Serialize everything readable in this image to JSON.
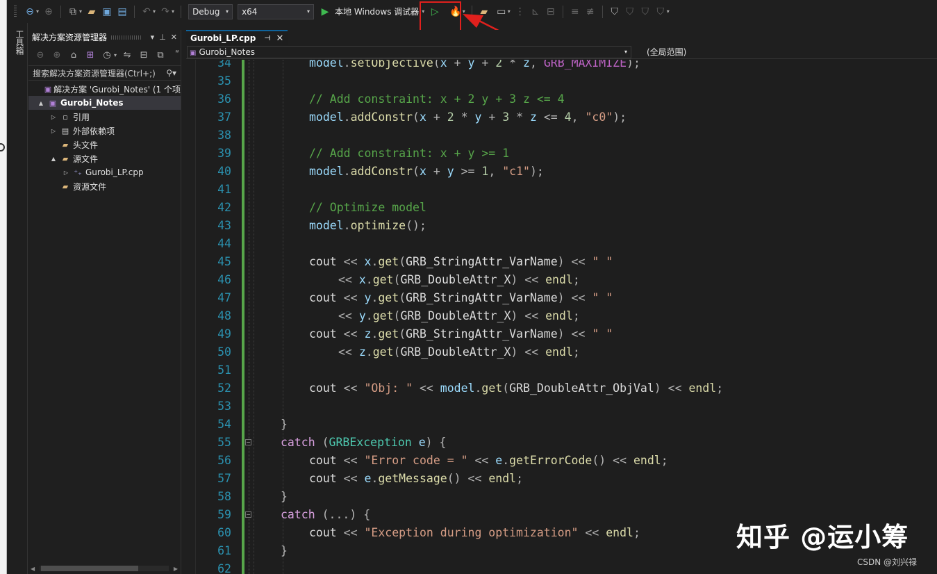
{
  "toolbar": {
    "configuration": "Debug",
    "platform": "x64",
    "run_label": "本地 Windows 调试器"
  },
  "tool_strip": {
    "label": "工具箱"
  },
  "solution_explorer": {
    "title": "解决方案资源管理器",
    "search_placeholder": "搜索解决方案资源管理器(Ctrl+;)",
    "tree": [
      {
        "label": "解决方案 'Gurobi_Notes' (1 个项",
        "icon": "solution-icon",
        "level": 0,
        "expander": ""
      },
      {
        "label": "Gurobi_Notes",
        "icon": "project-icon",
        "level": 0,
        "expander": "▲",
        "selected": true
      },
      {
        "label": "引用",
        "icon": "references-icon",
        "level": 1,
        "expander": "▷"
      },
      {
        "label": "外部依赖项",
        "icon": "external-deps-icon",
        "level": 1,
        "expander": "▷"
      },
      {
        "label": "头文件",
        "icon": "filter-folder-icon",
        "level": 1,
        "expander": ""
      },
      {
        "label": "源文件",
        "icon": "filter-folder-icon",
        "level": 1,
        "expander": "▲"
      },
      {
        "label": "Gurobi_LP.cpp",
        "icon": "cpp-file-icon",
        "level": 2,
        "expander": "▷"
      },
      {
        "label": "资源文件",
        "icon": "filter-folder-icon",
        "level": 1,
        "expander": ""
      }
    ]
  },
  "editor": {
    "tab_title": "Gurobi_LP.cpp",
    "nav_project": "Gurobi_Notes",
    "nav_scope": "(全局范围)",
    "lines": [
      {
        "n": "34",
        "indent": 2,
        "tokens": [
          [
            "model",
            "v"
          ],
          [
            ".",
            "p"
          ],
          [
            "setObjective",
            "f"
          ],
          [
            "(",
            "p"
          ],
          [
            "x",
            "v"
          ],
          [
            " + ",
            "o"
          ],
          [
            "y",
            "v"
          ],
          [
            " + ",
            "o"
          ],
          [
            "2",
            "n"
          ],
          [
            " * ",
            "o"
          ],
          [
            "z",
            "v"
          ],
          [
            ", ",
            "p"
          ],
          [
            "GRB_MAXIMIZE",
            "m"
          ],
          [
            ");",
            "p"
          ]
        ]
      },
      {
        "n": "35",
        "indent": 0,
        "tokens": []
      },
      {
        "n": "36",
        "indent": 2,
        "tokens": [
          [
            "// Add constraint: x + 2 y + 3 z <= 4",
            "c"
          ]
        ]
      },
      {
        "n": "37",
        "indent": 2,
        "tokens": [
          [
            "model",
            "v"
          ],
          [
            ".",
            "p"
          ],
          [
            "addConstr",
            "f"
          ],
          [
            "(",
            "p"
          ],
          [
            "x",
            "v"
          ],
          [
            " + ",
            "o"
          ],
          [
            "2",
            "n"
          ],
          [
            " * ",
            "o"
          ],
          [
            "y",
            "v"
          ],
          [
            " + ",
            "o"
          ],
          [
            "3",
            "n"
          ],
          [
            " * ",
            "o"
          ],
          [
            "z",
            "v"
          ],
          [
            " <= ",
            "o"
          ],
          [
            "4",
            "n"
          ],
          [
            ", ",
            "p"
          ],
          [
            "\"c0\"",
            "s"
          ],
          [
            ");",
            "p"
          ]
        ]
      },
      {
        "n": "38",
        "indent": 0,
        "tokens": []
      },
      {
        "n": "39",
        "indent": 2,
        "tokens": [
          [
            "// Add constraint: x + y >= 1",
            "c"
          ]
        ]
      },
      {
        "n": "40",
        "indent": 2,
        "tokens": [
          [
            "model",
            "v"
          ],
          [
            ".",
            "p"
          ],
          [
            "addConstr",
            "f"
          ],
          [
            "(",
            "p"
          ],
          [
            "x",
            "v"
          ],
          [
            " + ",
            "o"
          ],
          [
            "y",
            "v"
          ],
          [
            " >= ",
            "o"
          ],
          [
            "1",
            "n"
          ],
          [
            ", ",
            "p"
          ],
          [
            "\"c1\"",
            "s"
          ],
          [
            ");",
            "p"
          ]
        ]
      },
      {
        "n": "41",
        "indent": 0,
        "tokens": []
      },
      {
        "n": "42",
        "indent": 2,
        "tokens": [
          [
            "// Optimize model",
            "c"
          ]
        ]
      },
      {
        "n": "43",
        "indent": 2,
        "tokens": [
          [
            "model",
            "v"
          ],
          [
            ".",
            "p"
          ],
          [
            "optimize",
            "f"
          ],
          [
            "();",
            "p"
          ]
        ]
      },
      {
        "n": "44",
        "indent": 0,
        "tokens": []
      },
      {
        "n": "45",
        "indent": 2,
        "tokens": [
          [
            "cout",
            "x"
          ],
          [
            " << ",
            "o"
          ],
          [
            "x",
            "v"
          ],
          [
            ".",
            "p"
          ],
          [
            "get",
            "f"
          ],
          [
            "(",
            "p"
          ],
          [
            "GRB_StringAttr_VarName",
            "x"
          ],
          [
            ")",
            "p"
          ],
          [
            " << ",
            "o"
          ],
          [
            "\" \"",
            "s"
          ]
        ]
      },
      {
        "n": "46",
        "indent": 3,
        "tokens": [
          [
            "<< ",
            "o"
          ],
          [
            "x",
            "v"
          ],
          [
            ".",
            "p"
          ],
          [
            "get",
            "f"
          ],
          [
            "(",
            "p"
          ],
          [
            "GRB_DoubleAttr_X",
            "x"
          ],
          [
            ")",
            "p"
          ],
          [
            " << ",
            "o"
          ],
          [
            "endl",
            "f"
          ],
          [
            ";",
            "p"
          ]
        ]
      },
      {
        "n": "47",
        "indent": 2,
        "tokens": [
          [
            "cout",
            "x"
          ],
          [
            " << ",
            "o"
          ],
          [
            "y",
            "v"
          ],
          [
            ".",
            "p"
          ],
          [
            "get",
            "f"
          ],
          [
            "(",
            "p"
          ],
          [
            "GRB_StringAttr_VarName",
            "x"
          ],
          [
            ")",
            "p"
          ],
          [
            " << ",
            "o"
          ],
          [
            "\" \"",
            "s"
          ]
        ]
      },
      {
        "n": "48",
        "indent": 3,
        "tokens": [
          [
            "<< ",
            "o"
          ],
          [
            "y",
            "v"
          ],
          [
            ".",
            "p"
          ],
          [
            "get",
            "f"
          ],
          [
            "(",
            "p"
          ],
          [
            "GRB_DoubleAttr_X",
            "x"
          ],
          [
            ")",
            "p"
          ],
          [
            " << ",
            "o"
          ],
          [
            "endl",
            "f"
          ],
          [
            ";",
            "p"
          ]
        ]
      },
      {
        "n": "49",
        "indent": 2,
        "tokens": [
          [
            "cout",
            "x"
          ],
          [
            " << ",
            "o"
          ],
          [
            "z",
            "v"
          ],
          [
            ".",
            "p"
          ],
          [
            "get",
            "f"
          ],
          [
            "(",
            "p"
          ],
          [
            "GRB_StringAttr_VarName",
            "x"
          ],
          [
            ")",
            "p"
          ],
          [
            " << ",
            "o"
          ],
          [
            "\" \"",
            "s"
          ]
        ]
      },
      {
        "n": "50",
        "indent": 3,
        "tokens": [
          [
            "<< ",
            "o"
          ],
          [
            "z",
            "v"
          ],
          [
            ".",
            "p"
          ],
          [
            "get",
            "f"
          ],
          [
            "(",
            "p"
          ],
          [
            "GRB_DoubleAttr_X",
            "x"
          ],
          [
            ")",
            "p"
          ],
          [
            " << ",
            "o"
          ],
          [
            "endl",
            "f"
          ],
          [
            ";",
            "p"
          ]
        ]
      },
      {
        "n": "51",
        "indent": 0,
        "tokens": []
      },
      {
        "n": "52",
        "indent": 2,
        "tokens": [
          [
            "cout",
            "x"
          ],
          [
            " << ",
            "o"
          ],
          [
            "\"Obj: \"",
            "s"
          ],
          [
            " << ",
            "o"
          ],
          [
            "model",
            "v"
          ],
          [
            ".",
            "p"
          ],
          [
            "get",
            "f"
          ],
          [
            "(",
            "p"
          ],
          [
            "GRB_DoubleAttr_ObjVal",
            "x"
          ],
          [
            ")",
            "p"
          ],
          [
            " << ",
            "o"
          ],
          [
            "endl",
            "f"
          ],
          [
            ";",
            "p"
          ]
        ]
      },
      {
        "n": "53",
        "indent": 0,
        "tokens": []
      },
      {
        "n": "54",
        "indent": 1,
        "tokens": [
          [
            "}",
            "p"
          ]
        ]
      },
      {
        "n": "55",
        "indent": 1,
        "fold": true,
        "tokens": [
          [
            "catch",
            "k"
          ],
          [
            " (",
            "p"
          ],
          [
            "GRBException",
            "t"
          ],
          [
            " ",
            "p"
          ],
          [
            "e",
            "v"
          ],
          [
            ") {",
            "p"
          ]
        ]
      },
      {
        "n": "56",
        "indent": 2,
        "tokens": [
          [
            "cout",
            "x"
          ],
          [
            " << ",
            "o"
          ],
          [
            "\"Error code = \"",
            "s"
          ],
          [
            " << ",
            "o"
          ],
          [
            "e",
            "v"
          ],
          [
            ".",
            "p"
          ],
          [
            "getErrorCode",
            "f"
          ],
          [
            "()",
            "p"
          ],
          [
            " << ",
            "o"
          ],
          [
            "endl",
            "f"
          ],
          [
            ";",
            "p"
          ]
        ]
      },
      {
        "n": "57",
        "indent": 2,
        "tokens": [
          [
            "cout",
            "x"
          ],
          [
            " << ",
            "o"
          ],
          [
            "e",
            "v"
          ],
          [
            ".",
            "p"
          ],
          [
            "getMessage",
            "f"
          ],
          [
            "()",
            "p"
          ],
          [
            " << ",
            "o"
          ],
          [
            "endl",
            "f"
          ],
          [
            ";",
            "p"
          ]
        ]
      },
      {
        "n": "58",
        "indent": 1,
        "tokens": [
          [
            "}",
            "p"
          ]
        ]
      },
      {
        "n": "59",
        "indent": 1,
        "fold": true,
        "tokens": [
          [
            "catch",
            "k"
          ],
          [
            " (...) {",
            "p"
          ]
        ]
      },
      {
        "n": "60",
        "indent": 2,
        "tokens": [
          [
            "cout",
            "x"
          ],
          [
            " << ",
            "o"
          ],
          [
            "\"Exception during optimization\"",
            "s"
          ],
          [
            " << ",
            "o"
          ],
          [
            "endl",
            "f"
          ],
          [
            ";",
            "p"
          ]
        ]
      },
      {
        "n": "61",
        "indent": 1,
        "tokens": [
          [
            "}",
            "p"
          ]
        ]
      },
      {
        "n": "62",
        "indent": 0,
        "tokens": []
      }
    ]
  },
  "watermarks": {
    "zhihu": "知乎 @运小筹",
    "csdn": "CSDN @刘兴禄"
  },
  "colors": {
    "highlight_box": "#e0201d",
    "arrow": "#e0201d",
    "change_bar": "#57a64a",
    "line_number": "#2b91af"
  }
}
